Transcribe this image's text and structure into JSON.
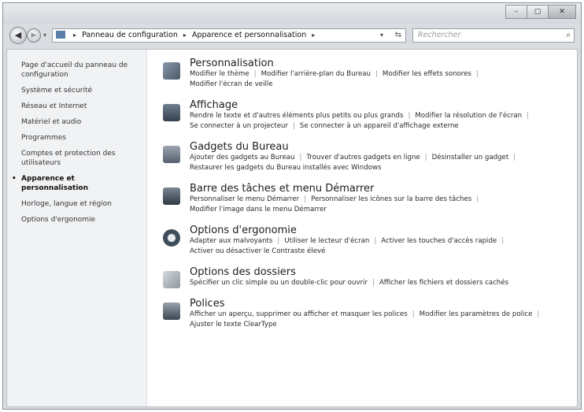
{
  "window": {
    "controls": {
      "minimize": "–",
      "maximize": "▢",
      "close": "✕"
    }
  },
  "toolbar": {
    "back": "◀",
    "forward": "▶",
    "nav_dropdown": "▾",
    "crumbs": [
      "Panneau de configuration",
      "Apparence et personnalisation"
    ],
    "separator": "▸",
    "address_dropdown": "▾",
    "refresh": "⇆",
    "search_placeholder": "Rechercher",
    "search_icon": "⌕"
  },
  "sidebar": {
    "items": [
      {
        "label": "Page d'accueil du panneau de configuration"
      },
      {
        "label": "Système et sécurité"
      },
      {
        "label": "Réseau et Internet"
      },
      {
        "label": "Matériel et audio"
      },
      {
        "label": "Programmes"
      },
      {
        "label": "Comptes et protection des utilisateurs"
      },
      {
        "label": "Apparence et personnalisation"
      },
      {
        "label": "Horloge, langue et région"
      },
      {
        "label": "Options d'ergonomie"
      }
    ]
  },
  "categories": [
    {
      "title": "Personnalisation",
      "icon": "personalization-icon",
      "color": "#5b6b7d",
      "links": [
        "Modifier le thème",
        "Modifier l'arrière-plan du Bureau",
        "Modifier les effets sonores",
        "Modifier l'écran de veille"
      ]
    },
    {
      "title": "Affichage",
      "icon": "display-icon",
      "color": "#4d5c6e",
      "links": [
        "Rendre le texte et d'autres éléments plus petits ou plus grands",
        "Modifier la résolution de l'écran",
        "Se connecter à un projecteur",
        "Se connecter à un appareil d'affichage externe"
      ]
    },
    {
      "title": "Gadgets du Bureau",
      "icon": "gadgets-icon",
      "color": "#6f7b88",
      "links": [
        "Ajouter des gadgets au Bureau",
        "Trouver d'autres gadgets en ligne",
        "Désinstaller un gadget",
        "Restaurer les gadgets du Bureau installés avec Windows"
      ]
    },
    {
      "title": "Barre des tâches et menu Démarrer",
      "icon": "taskbar-icon",
      "color": "#555f6b",
      "links": [
        "Personnaliser le menu Démarrer",
        "Personnaliser les icônes sur la barre des tâches",
        "Modifier l'image dans le menu Démarrer"
      ]
    },
    {
      "title": "Options d'ergonomie",
      "icon": "ergonomics-icon",
      "color": "#3f4c5a",
      "links": [
        "Adapter aux malvoyants",
        "Utiliser le lecteur d'écran",
        "Activer les touches d'accès rapide",
        "Activer ou désactiver le Contraste élevé"
      ]
    },
    {
      "title": "Options des dossiers",
      "icon": "folder-options-icon",
      "color": "#9ea4aa",
      "links": [
        "Spécifier un clic simple ou un double-clic pour ouvrir",
        "Afficher les fichiers et dossiers cachés"
      ]
    },
    {
      "title": "Polices",
      "icon": "fonts-icon",
      "color": "#4a5563",
      "links": [
        "Afficher un aperçu, supprimer ou afficher et masquer les polices",
        "Modifier les paramètres de police",
        "Ajuster le texte ClearType"
      ]
    }
  ]
}
